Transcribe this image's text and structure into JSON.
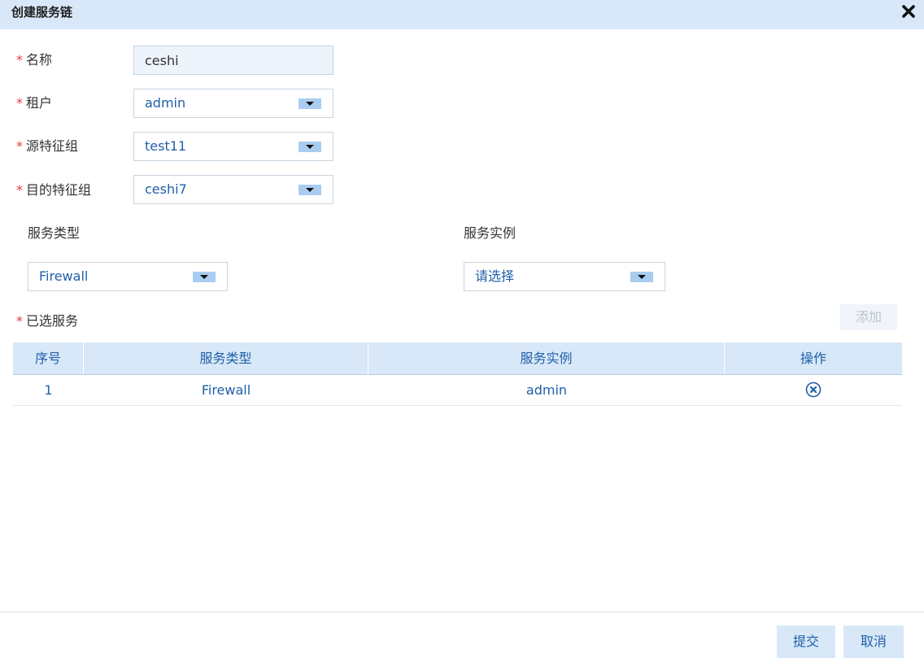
{
  "dialog": {
    "title": "创建服务链",
    "close_icon": "close-icon"
  },
  "form": {
    "required_mark": "*",
    "name": {
      "label": "名称",
      "value": "ceshi"
    },
    "tenant": {
      "label": "租户",
      "value": "admin"
    },
    "source_group": {
      "label": "源特征组",
      "value": "test11"
    },
    "dest_group": {
      "label": "目的特征组",
      "value": "ceshi7"
    }
  },
  "service": {
    "type_label": "服务类型",
    "type_value": "Firewall",
    "instance_label": "服务实例",
    "instance_value": "请选择"
  },
  "selected": {
    "label": "已选服务",
    "add_label": "添加",
    "columns": [
      "序号",
      "服务类型",
      "服务实例",
      "操作"
    ],
    "rows": [
      {
        "index": "1",
        "type": "Firewall",
        "instance": "admin",
        "action_icon": "remove-icon"
      }
    ]
  },
  "footer": {
    "submit_label": "提交",
    "cancel_label": "取消"
  },
  "colors": {
    "titlebar": "#d8e8f8",
    "accent_text": "#1f5fa8",
    "required": "#e4393c",
    "arrow_bg": "#a9cdf0"
  }
}
